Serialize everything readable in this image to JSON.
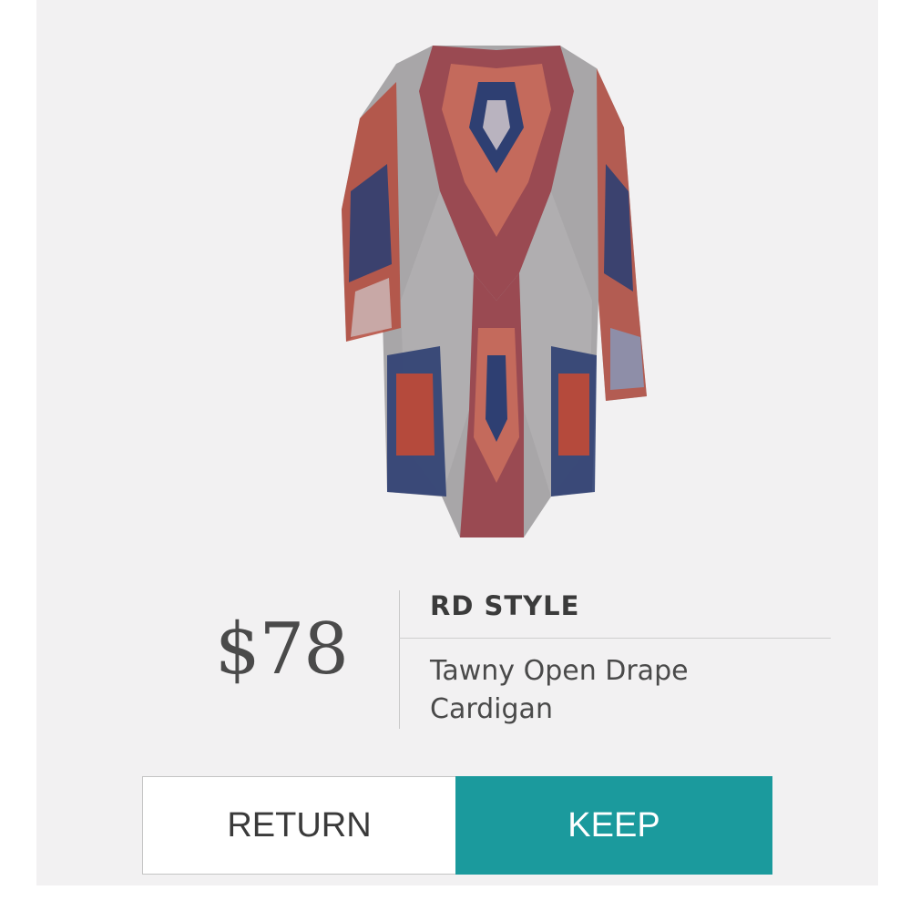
{
  "product": {
    "image_alt": "Tawny Open Drape Cardigan",
    "price": "$78",
    "brand": "RD STYLE",
    "name_line1": "Tawny Open Drape",
    "name_line2": "Cardigan"
  },
  "actions": {
    "return_label": "RETURN",
    "keep_label": "KEEP"
  },
  "colors": {
    "keep_accent": "#1b9a9d",
    "card_background": "#f2f1f2"
  }
}
